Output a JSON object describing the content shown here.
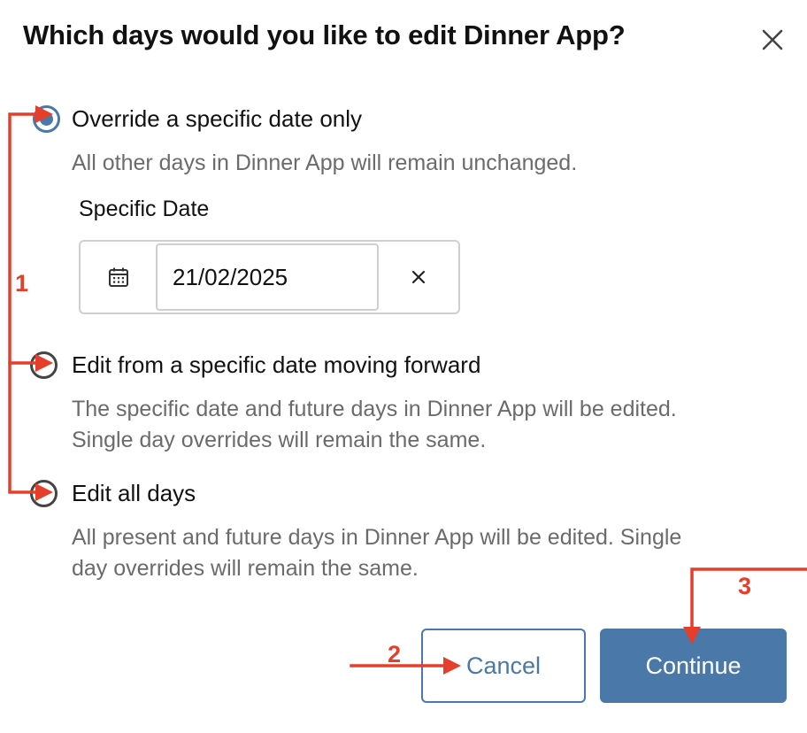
{
  "dialog": {
    "title": "Which days would you like to edit Dinner App?",
    "close_icon": "close-icon"
  },
  "options": [
    {
      "label": "Override a specific date only",
      "description": "All other days in Dinner App will remain unchanged.",
      "checked": true
    },
    {
      "label": "Edit from a specific date moving forward",
      "description_lines": [
        "The specific date and future days in Dinner App will be edited.",
        "Single day overrides will remain the same."
      ],
      "checked": false
    },
    {
      "label": "Edit all days",
      "description_lines": [
        "All present and future days in Dinner App will be edited. Single",
        "day overrides will remain the same."
      ],
      "checked": false
    }
  ],
  "specific_date": {
    "label": "Specific Date",
    "value": "21/02/2025",
    "calendar_icon": "calendar-icon",
    "clear_icon": "clear-icon"
  },
  "actions": {
    "cancel_label": "Cancel",
    "continue_label": "Continue"
  },
  "annotations": {
    "step_1": "1",
    "step_2": "2",
    "step_3": "3",
    "color": "#e53e2b"
  },
  "colors": {
    "accent": "#4a78a8",
    "muted_text": "#6b6b6b",
    "border": "#cfcfcf"
  }
}
